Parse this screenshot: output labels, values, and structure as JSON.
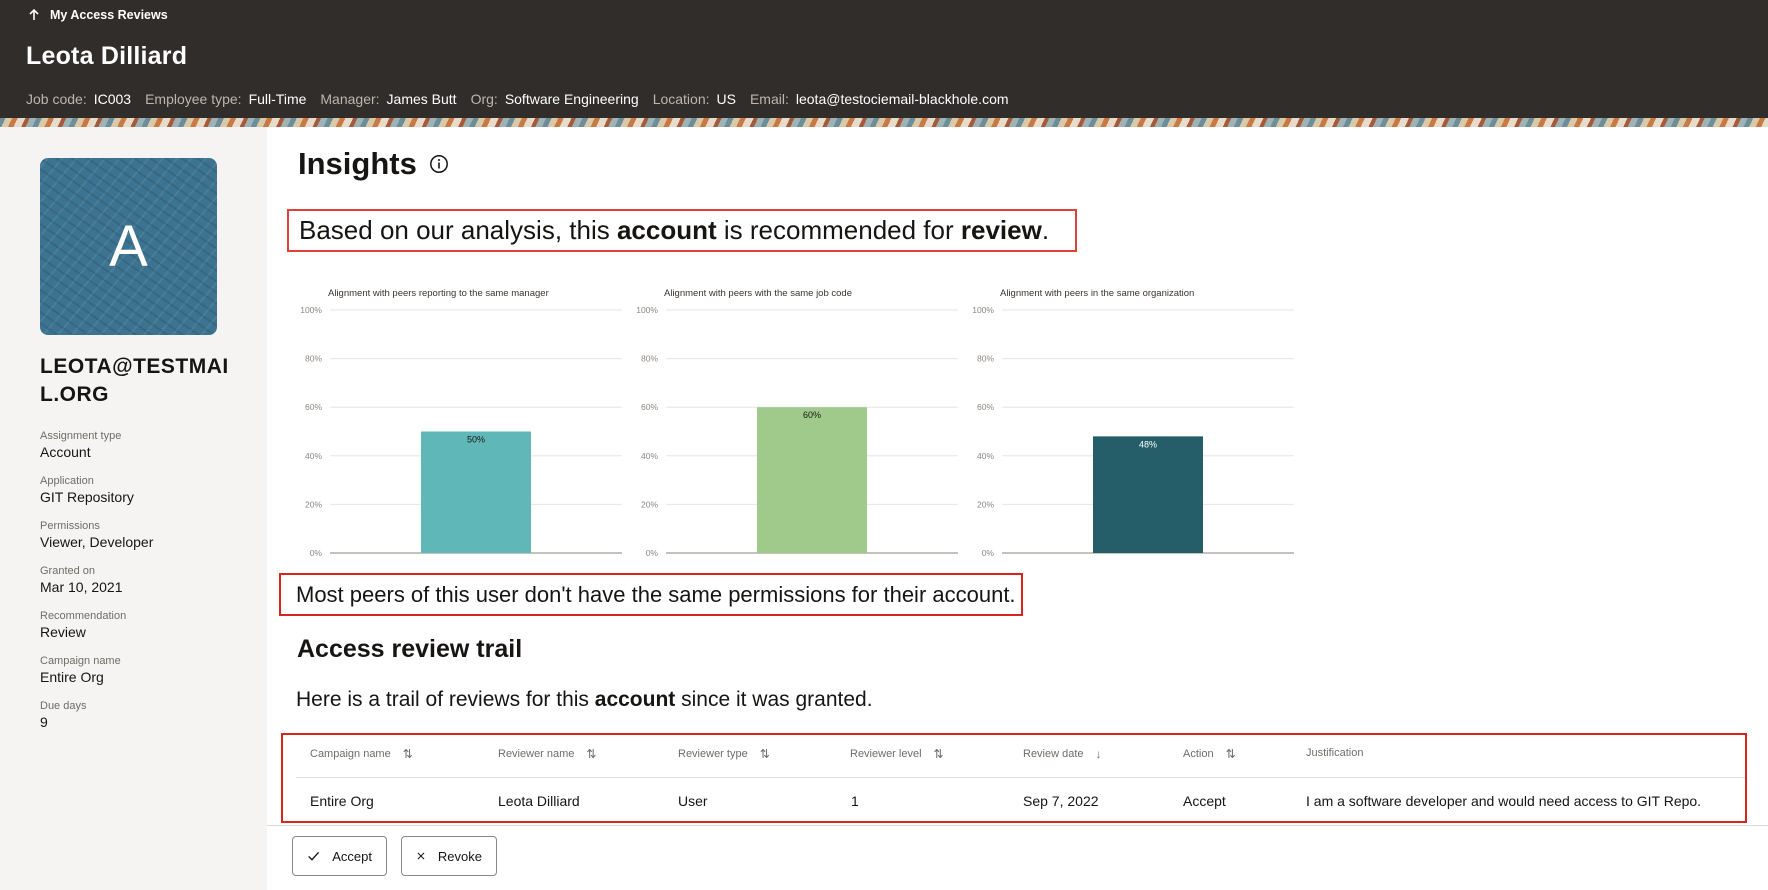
{
  "header": {
    "back_label": "My Access Reviews",
    "user_name": "Leota Dilliard",
    "meta": [
      {
        "label": "Job code:",
        "value": "IC003"
      },
      {
        "label": "Employee type:",
        "value": "Full-Time"
      },
      {
        "label": "Manager:",
        "value": "James Butt"
      },
      {
        "label": "Org:",
        "value": "Software Engineering"
      },
      {
        "label": "Location:",
        "value": "US"
      },
      {
        "label": "Email:",
        "value": "leota@testociemail-blackhole.com"
      }
    ]
  },
  "sidebar": {
    "avatar_initial": "A",
    "account_name": "LEOTA@TESTMAIL.ORG",
    "details": [
      {
        "label": "Assignment type",
        "value": "Account"
      },
      {
        "label": "Application",
        "value": "GIT Repository"
      },
      {
        "label": "Permissions",
        "value": "Viewer, Developer"
      },
      {
        "label": "Granted on",
        "value": "Mar 10, 2021"
      },
      {
        "label": "Recommendation",
        "value": "Review"
      },
      {
        "label": "Campaign name",
        "value": "Entire Org"
      },
      {
        "label": "Due days",
        "value": "9"
      }
    ]
  },
  "insights": {
    "title": "Insights",
    "reco_prefix": "Based on our analysis, this ",
    "reco_bold1": "account",
    "reco_mid": " is recommended for ",
    "reco_bold2": "review",
    "reco_suffix": ".",
    "peers_text": "Most peers of this user don't have the same permissions for their account."
  },
  "chart_data": [
    {
      "type": "bar",
      "title": "Alignment with peers reporting to the same manager",
      "categories": [
        ""
      ],
      "values": [
        50
      ],
      "value_labels": [
        "50%"
      ],
      "ylim": [
        0,
        100
      ],
      "yticks": [
        "100%",
        "80%",
        "60%",
        "40%",
        "20%",
        "0%"
      ],
      "color": "#5fb8b7",
      "label_color": "#161513"
    },
    {
      "type": "bar",
      "title": "Alignment with peers with the same job code",
      "categories": [
        ""
      ],
      "values": [
        60
      ],
      "value_labels": [
        "60%"
      ],
      "ylim": [
        0,
        100
      ],
      "yticks": [
        "100%",
        "80%",
        "60%",
        "40%",
        "20%",
        "0%"
      ],
      "color": "#a0ca8b",
      "label_color": "#161513"
    },
    {
      "type": "bar",
      "title": "Alignment with peers in the same organization",
      "categories": [
        ""
      ],
      "values": [
        48
      ],
      "value_labels": [
        "48%"
      ],
      "ylim": [
        0,
        100
      ],
      "yticks": [
        "100%",
        "80%",
        "60%",
        "40%",
        "20%",
        "0%"
      ],
      "color": "#255e68",
      "label_color": "#ffffff"
    }
  ],
  "trail": {
    "title": "Access review trail",
    "desc_prefix": "Here is a trail of reviews for this ",
    "desc_bold": "account",
    "desc_suffix": " since it was granted.",
    "columns": [
      "Campaign name",
      "Reviewer name",
      "Reviewer type",
      "Reviewer level",
      "Review date",
      "Action",
      "Justification"
    ],
    "rows": [
      [
        "Entire Org",
        "Leota Dilliard",
        "User",
        "1",
        "Sep 7, 2022",
        "Accept",
        "I am a software developer and would need access to GIT Repo."
      ]
    ]
  },
  "actions": {
    "accept_label": "Accept",
    "revoke_label": "Revoke"
  }
}
